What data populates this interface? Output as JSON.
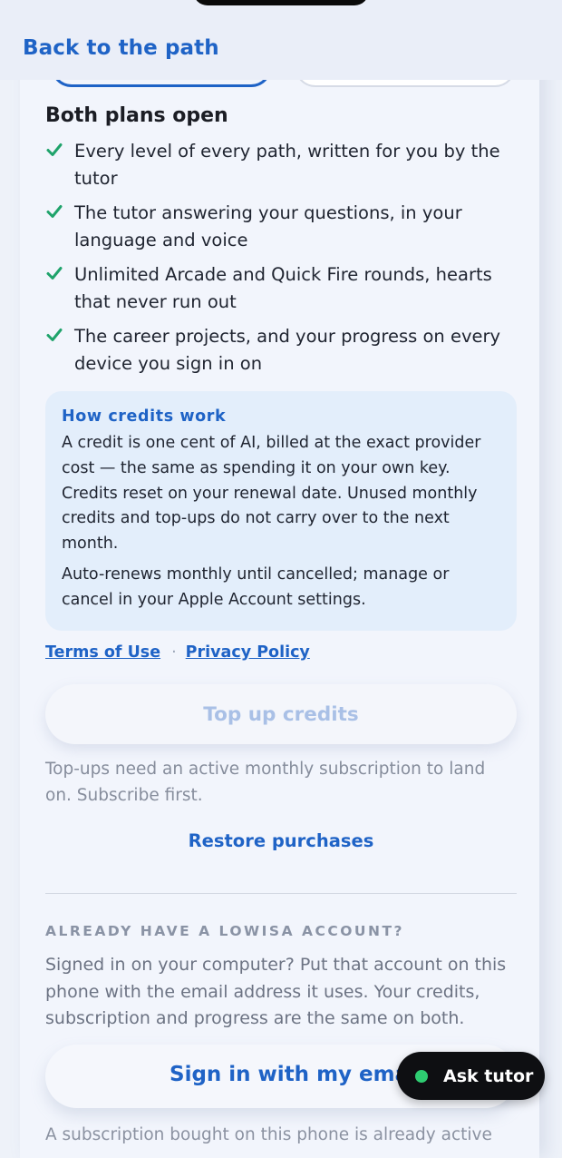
{
  "nav": {
    "back_label": "Back to the path"
  },
  "plans": {
    "title": "Both plans open",
    "features": [
      "Every level of every path, written for you by the tutor",
      "The tutor answering your questions, in your language and voice",
      "Unlimited Arcade and Quick Fire rounds, hearts that never run out",
      "The career projects, and your progress on every device you sign in on"
    ]
  },
  "credits_info": {
    "title": "How credits work",
    "paragraph_1": "A credit is one cent of AI, billed at the exact provider cost — the same as spending it on your own key. Credits reset on your renewal date. Unused monthly credits and top-ups do not carry over to the next month.",
    "paragraph_2": "Auto-renews monthly until cancelled; manage or cancel in your Apple Account settings."
  },
  "legal": {
    "terms": "Terms of Use",
    "separator": "·",
    "privacy": "Privacy Policy"
  },
  "topup": {
    "button_label": "Top up credits",
    "note": "Top-ups need an active monthly subscription to land on. Subscribe first."
  },
  "restore_label": "Restore purchases",
  "account": {
    "heading": "ALREADY HAVE A LOWISA ACCOUNT?",
    "body": "Signed in on your computer? Put that account on this phone with the email address it uses. Your credits, subscription and progress are the same on both.",
    "signin_label": "Sign in with my email",
    "bottom_note": "A subscription bought on this phone is already active"
  },
  "tutor": {
    "label": "Ask tutor",
    "status_color": "#2ecc71"
  },
  "colors": {
    "accent": "#1f63c6",
    "check": "#1fa36b"
  }
}
